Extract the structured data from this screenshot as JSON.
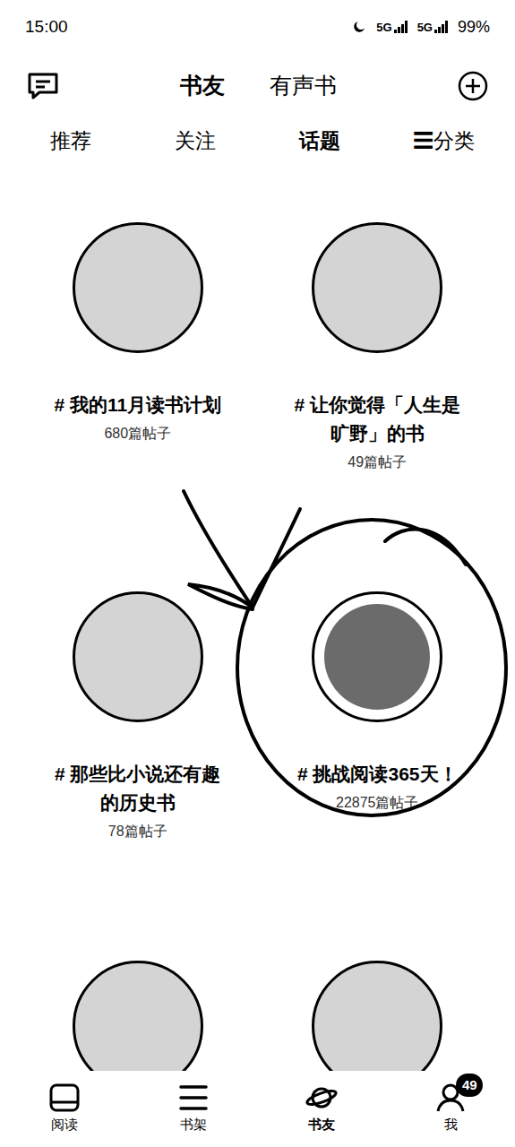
{
  "status_bar": {
    "time": "15:00",
    "network": [
      "5G",
      "5G"
    ],
    "battery": "99%"
  },
  "header_tabs": [
    {
      "label": "书友",
      "selected": true
    },
    {
      "label": "有声书",
      "selected": false
    }
  ],
  "sub_tabs": [
    {
      "label": "推荐",
      "selected": false
    },
    {
      "label": "关注",
      "selected": false
    },
    {
      "label": "话题",
      "selected": true
    },
    {
      "label": "☰分类",
      "selected": false
    }
  ],
  "topics": [
    {
      "title": "# 我的11月读书计划",
      "posts": "680篇帖子"
    },
    {
      "title": "# 让你觉得「人生是旷野」的书",
      "posts": "49篇帖子"
    },
    {
      "title": "# 那些比小说还有趣的历史书",
      "posts": "78篇帖子"
    },
    {
      "title": "# 挑战阅读365天！",
      "posts": "22875篇帖子"
    }
  ],
  "bottom_nav": [
    {
      "label": "阅读",
      "selected": false,
      "badge": ""
    },
    {
      "label": "书架",
      "selected": false,
      "badge": ""
    },
    {
      "label": "书友",
      "selected": true,
      "badge": ""
    },
    {
      "label": "我",
      "selected": false,
      "badge": "49"
    }
  ]
}
